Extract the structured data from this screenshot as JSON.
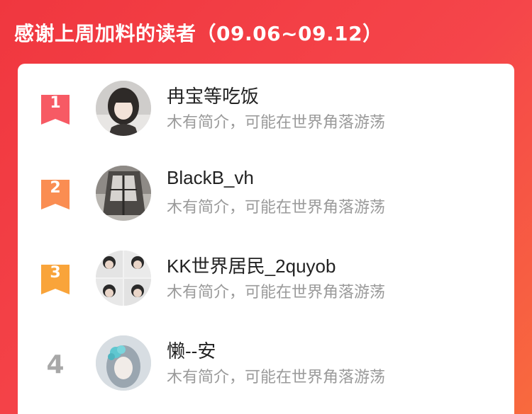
{
  "header": {
    "title": "感谢上周加料的读者（09.06~09.12）"
  },
  "colors": {
    "background_start": "#f0373f",
    "background_end": "#f86a3e",
    "rank1": "#f75a64",
    "rank2": "#fa8d52",
    "rank3": "#f9a43a",
    "rank_plain": "#a8a8a8",
    "name": "#222222",
    "desc": "#9a9a9a"
  },
  "readers": [
    {
      "rank": "1",
      "name": "冉宝等吃饭",
      "desc": "木有简介，可能在世界角落游荡",
      "badge_icon": "ribbon-badge-icon"
    },
    {
      "rank": "2",
      "name": "BlackB_vh",
      "desc": "木有简介，可能在世界角落游荡",
      "badge_icon": "ribbon-badge-icon"
    },
    {
      "rank": "3",
      "name": "KK世界居民_2quyob",
      "desc": "木有简介，可能在世界角落游荡",
      "badge_icon": "ribbon-badge-icon"
    },
    {
      "rank": "4",
      "name": "懒--安",
      "desc": "木有简介，可能在世界角落游荡"
    }
  ]
}
